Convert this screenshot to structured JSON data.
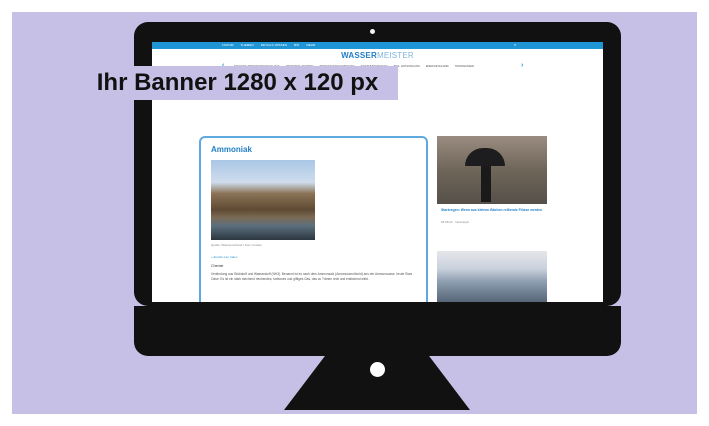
{
  "banner": {
    "text": "Ihr Banner 1280 x 120 px"
  },
  "site": {
    "logo_bold": "WASSER",
    "logo_light": "MEISTER",
    "top_nav": [
      "FORUM",
      "THEMEN",
      "DETAILS WISSEN",
      "BW",
      "MEHR"
    ],
    "search_icon": "search-icon",
    "category_nav": [
      "STUDIUM / TRINKWASSERQUALITÄT",
      "ABWASSER / PUMPEN",
      "TRINKWASSERGEWINNUNG",
      "INSTRUMENTIERUNG",
      "BIOL. ENTSORGUNG",
      "ENERGIETECHNIK",
      "TRINKWASSER"
    ]
  },
  "article": {
    "title": "Ammoniak",
    "photo_caption": "Quelle: Wasserverband / Foto: Fotolia",
    "back_link": "« Zurück zum Index",
    "section_label": "Chemie",
    "body": "Verbindung aus Stickstoff und Wasserstoff (NH3). Benannt ist es nach dem Ammonsalz (Ammoniumchlorid) aus der Ammonsoase, heute Siwa Oase. Es ist ein stark stechend riechendes, farbloses und giftiges Gas, das zu Tränen reizt und erstickend wirkt."
  },
  "sidebar": {
    "card1_title": "Starkregen: Wenn aus kleinen Bächen reißende Flüsse werden",
    "card1_meta": "05.08.22 · Newstopic"
  },
  "colors": {
    "banner_bg": "#c7c0e6",
    "accent": "#1f95d6",
    "bezel": "#111111"
  }
}
